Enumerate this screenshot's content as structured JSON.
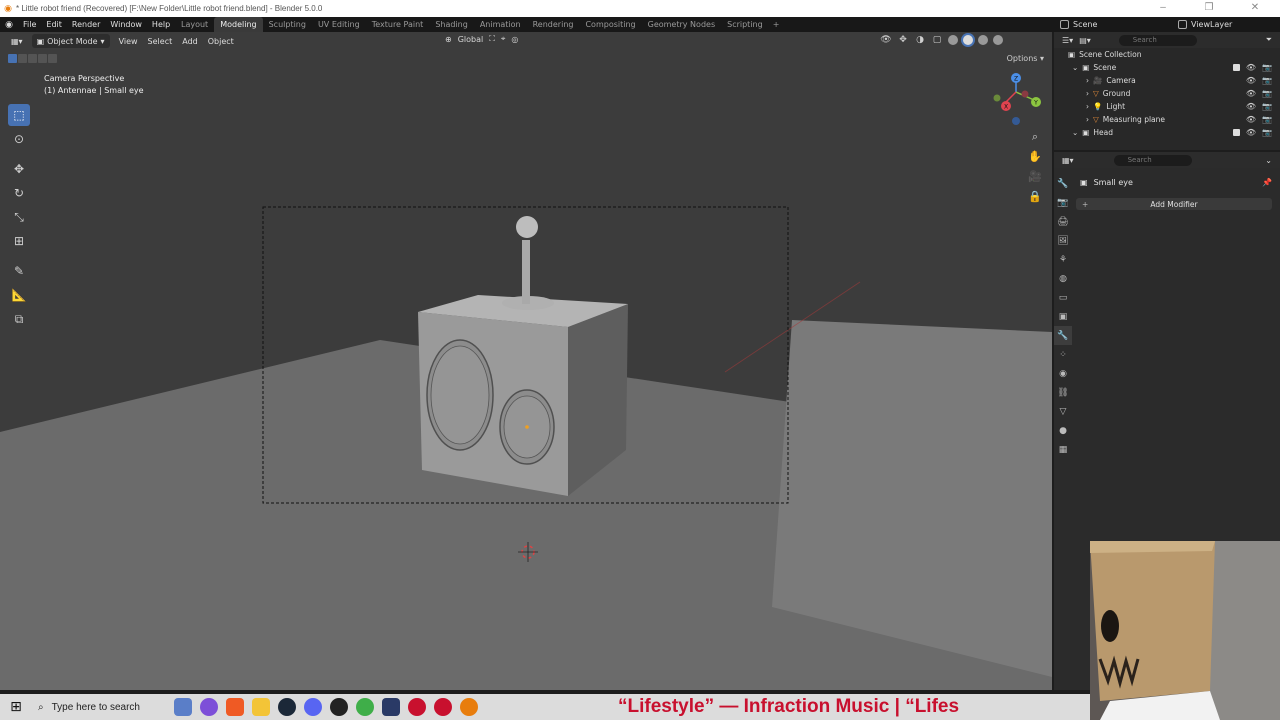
{
  "window": {
    "title": "* Little robot friend (Recovered) [F:\\New Folder\\Little robot friend.blend] - Blender 5.0.0"
  },
  "menu": [
    "File",
    "Edit",
    "Render",
    "Window",
    "Help"
  ],
  "workspaces": [
    "Layout",
    "Modeling",
    "Sculpting",
    "UV Editing",
    "Texture Paint",
    "Shading",
    "Animation",
    "Rendering",
    "Compositing",
    "Geometry Nodes",
    "Scripting"
  ],
  "active_workspace": "Modeling",
  "scene_name": "Scene",
  "view_layer": "ViewLayer",
  "viewport": {
    "mode": "Object Mode",
    "menus": [
      "View",
      "Select",
      "Add",
      "Object"
    ],
    "orientation": "Global",
    "options_label": "Options",
    "overlay_title": "Camera Perspective",
    "overlay_subtitle": "(1) Antennae | Small eye"
  },
  "gizmo_axes": {
    "x": "X",
    "y": "Y",
    "z": "Z"
  },
  "outliner": {
    "search_placeholder": "Search",
    "root": "Scene Collection",
    "items": [
      {
        "label": "Scene",
        "level": 1,
        "icon": "collection-icon"
      },
      {
        "label": "Camera",
        "level": 2,
        "icon": "camera-icon"
      },
      {
        "label": "Ground",
        "level": 2,
        "icon": "mesh-icon"
      },
      {
        "label": "Light",
        "level": 2,
        "icon": "light-icon"
      },
      {
        "label": "Measuring plane",
        "level": 2,
        "icon": "mesh-icon"
      },
      {
        "label": "Head",
        "level": 1,
        "icon": "collection-icon"
      }
    ]
  },
  "properties": {
    "search_placeholder": "Search",
    "object_name": "Small eye",
    "add_modifier_label": "Add Modifier"
  },
  "taskbar": {
    "search_placeholder": "Type here to search",
    "ticker": "“Lifestyle” — Infraction Music      |      “Lifes"
  },
  "colors": {
    "accent": "#4772b3",
    "viewport_bg": "#3d3d3d",
    "ticker": "#c8102e",
    "axis_x": "#e0434f",
    "axis_y": "#8cc540",
    "axis_z": "#4b8fe8"
  }
}
